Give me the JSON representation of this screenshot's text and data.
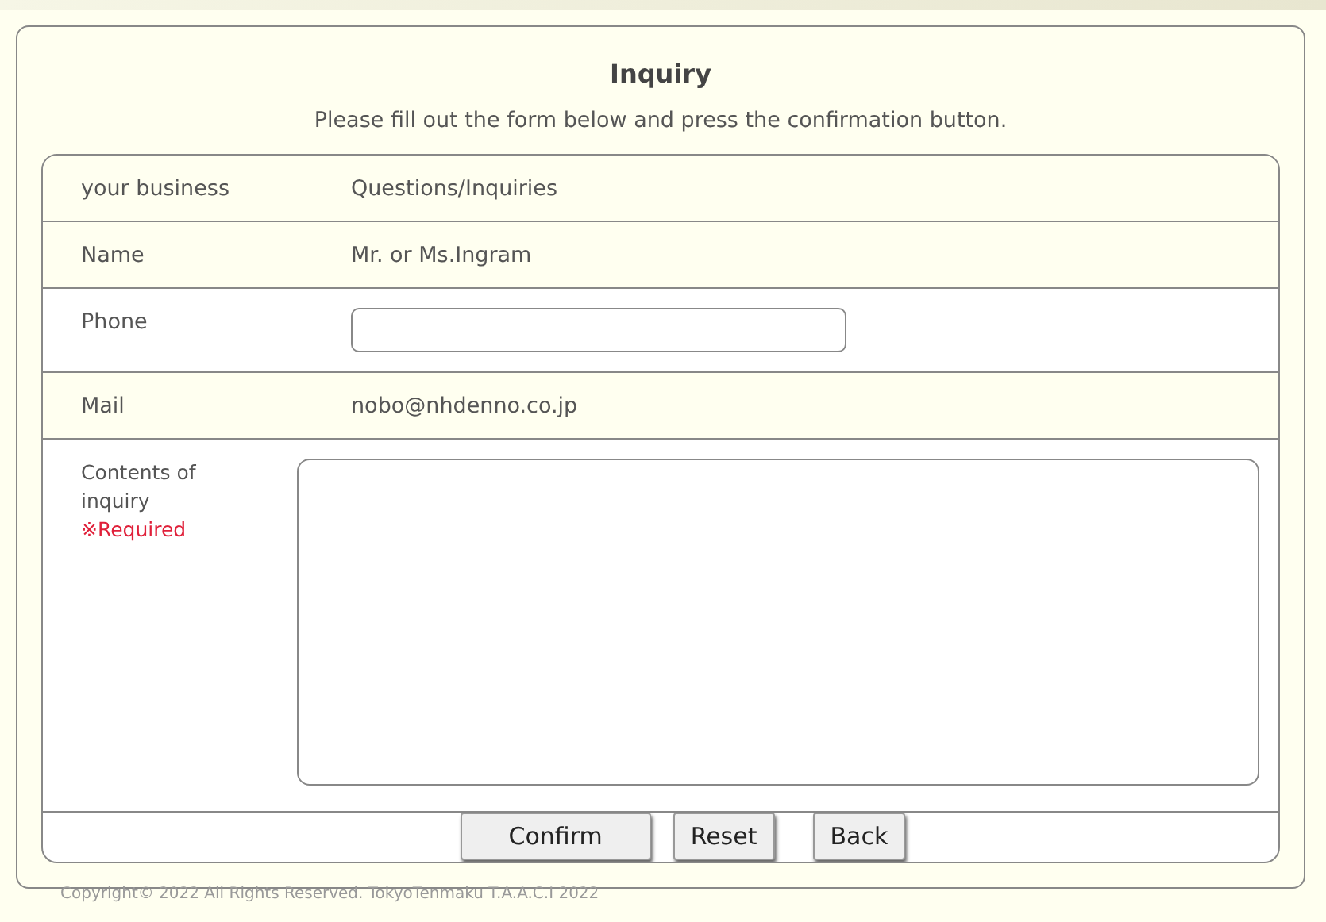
{
  "title": "Inquiry",
  "intro": "Please fill out the form below and press the confirmation button.",
  "rows": [
    {
      "kind": "text",
      "label": "your business",
      "value": "Questions/Inquiries"
    },
    {
      "kind": "text",
      "label": "Name",
      "value": "Mr. or Ms.Ingram"
    },
    {
      "kind": "input",
      "label": "Phone"
    },
    {
      "kind": "text",
      "label": "Mail",
      "value": "nobo@nhdenno.co.jp"
    },
    {
      "kind": "textarea",
      "label": "Contents of inquiry",
      "note": "※Required"
    }
  ],
  "buttons": [
    "Confirm",
    "Reset",
    "Back"
  ],
  "copyright": "Copyright© 2022 All Rights Reserved. TokyoTenmaku T.A.A.C.I 2022"
}
